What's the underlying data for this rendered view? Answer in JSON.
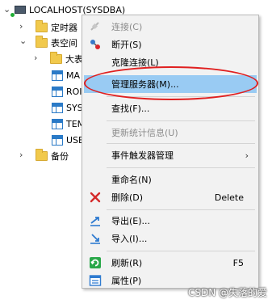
{
  "tree": {
    "root_label": "LOCALHOST(SYSDBA)",
    "items": [
      {
        "label": "定时器"
      },
      {
        "label": "表空间"
      },
      {
        "label": "大表"
      },
      {
        "label": "MA"
      },
      {
        "label": "ROI"
      },
      {
        "label": "SYS"
      },
      {
        "label": "TEM"
      },
      {
        "label": "USE"
      },
      {
        "label": "备份"
      }
    ]
  },
  "menu": {
    "items": [
      {
        "label": "连接(C)",
        "icon": "connect-icon",
        "enabled": false
      },
      {
        "label": "断开(S)",
        "icon": "disconnect-icon",
        "enabled": true
      },
      {
        "label": "克隆连接(L)",
        "icon": "",
        "enabled": true
      },
      {
        "label": "管理服务器(M)...",
        "icon": "",
        "enabled": true,
        "selected": true
      },
      {
        "label": "查找(F)...",
        "icon": "",
        "enabled": true
      },
      {
        "label": "更新统计信息(U)",
        "icon": "",
        "enabled": false
      },
      {
        "label": "事件触发器管理",
        "icon": "",
        "enabled": true,
        "submenu": true
      },
      {
        "label": "重命名(N)",
        "icon": "",
        "enabled": true
      },
      {
        "label": "删除(D)",
        "shortcut": "Delete",
        "icon": "delete-icon",
        "enabled": true
      },
      {
        "label": "导出(E)...",
        "icon": "export-icon",
        "enabled": true
      },
      {
        "label": "导入(I)...",
        "icon": "import-icon",
        "enabled": true
      },
      {
        "label": "刷新(R)",
        "shortcut": "F5",
        "icon": "refresh-icon",
        "enabled": true
      },
      {
        "label": "属性(P)",
        "icon": "properties-icon",
        "enabled": true
      }
    ],
    "submenu_arrow": "›"
  },
  "watermark": "CSDN @失落的爱",
  "colors": {
    "highlight": "#99cbf3",
    "annotation": "#e02020",
    "folder": "#f1c94c"
  }
}
